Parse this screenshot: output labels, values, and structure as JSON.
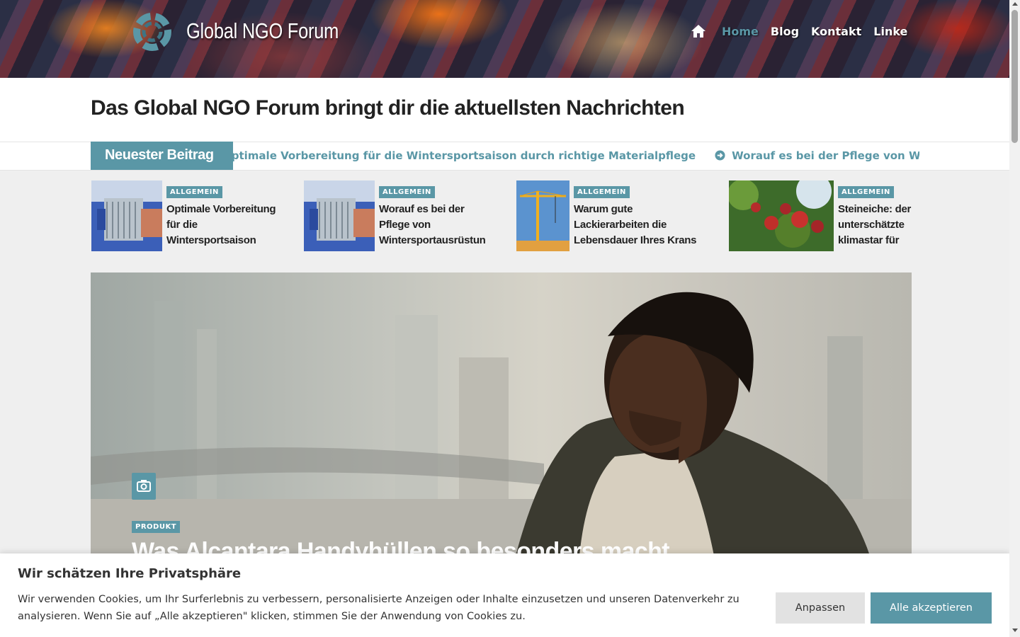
{
  "header": {
    "site_title": "Global NGO Forum",
    "nav": [
      {
        "label": "Home",
        "active": true
      },
      {
        "label": "Blog",
        "active": false
      },
      {
        "label": "Kontakt",
        "active": false
      },
      {
        "label": "Linke",
        "active": false
      }
    ]
  },
  "headline": "Das Global NGO Forum bringt dir die aktuellsten Nachrichten",
  "ticker": {
    "label": "Neuester Beitrag",
    "items": [
      "Optimale Vorbereitung für die Wintersportsaison durch richtige Materialpflege",
      "Worauf es bei der Pflege von Wintersportausrüstung"
    ]
  },
  "cards": [
    {
      "category": "ALLGEMEIN",
      "title": "Optimale Vorbereitung für die Wintersportsaison"
    },
    {
      "category": "ALLGEMEIN",
      "title": "Worauf es bei der Pflege von Wintersportausrüstun"
    },
    {
      "category": "ALLGEMEIN",
      "title": "Warum gute Lackierarbeiten die Lebensdauer Ihres Krans"
    },
    {
      "category": "ALLGEMEIN",
      "title": "Steineiche: der unterschätzte klimastar für"
    }
  ],
  "hero": {
    "category": "PRODUKT",
    "title": "Was Alcantara Handyhüllen so besonders macht"
  },
  "cookie": {
    "title": "Wir schätzen Ihre Privatsphäre",
    "text": "Wir verwenden Cookies, um Ihr Surferlebnis zu verbessern, personalisierte Anzeigen oder Inhalte einzusetzen und unseren Datenverkehr zu analysieren. Wenn Sie auf „Alle akzeptieren\" klicken, stimmen Sie der Anwendung von Cookies zu.",
    "customize_label": "Anpassen",
    "accept_label": "Alle akzeptieren"
  },
  "colors": {
    "accent": "#5a97a6"
  }
}
